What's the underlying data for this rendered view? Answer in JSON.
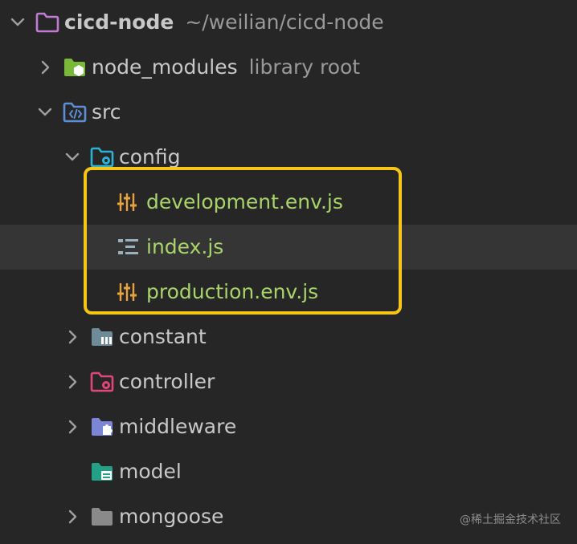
{
  "project": {
    "name": "cicd-node",
    "path": "~/weilian/cicd-node"
  },
  "tree": {
    "node_modules": {
      "label": "node_modules",
      "hint": "library root"
    },
    "src": {
      "label": "src"
    },
    "config": {
      "label": "config"
    },
    "files": {
      "development": "development.env.js",
      "index": "index.js",
      "production": "production.env.js"
    },
    "constant": {
      "label": "constant"
    },
    "controller": {
      "label": "controller"
    },
    "middleware": {
      "label": "middleware"
    },
    "model": {
      "label": "model"
    },
    "mongoose": {
      "label": "mongoose"
    }
  },
  "watermark": "@稀土掘金技术社区",
  "colors": {
    "background": "#262626",
    "selected_row": "#353535",
    "highlight_border": "#f5c518",
    "js_file_text": "#a9d46a",
    "root_folder_icon": "#c17bd6",
    "library_folder_icon": "#7ab83a",
    "src_folder_icon": "#5c8fd6",
    "config_folder_icon": "#2bb3d6",
    "constant_folder_icon": "#6f8a98",
    "controller_folder_icon": "#e0457b",
    "middleware_folder_icon": "#7b86d6",
    "model_folder_icon": "#24a087",
    "plain_folder_icon": "#8a8a8a",
    "env_file_icon": "#e8a33d"
  }
}
